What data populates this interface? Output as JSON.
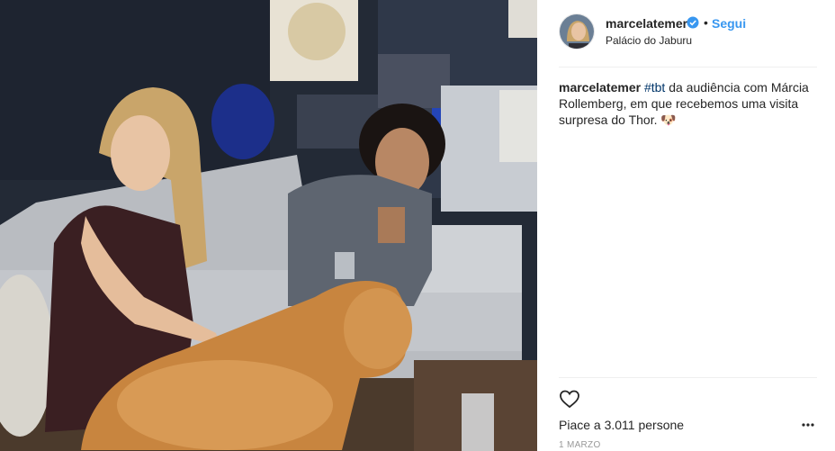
{
  "post": {
    "photo_description_icon": "photo",
    "username": "marcelatemer",
    "verified_icon": "verified-badge-icon",
    "separator": "•",
    "follow_label": "Segui",
    "location": "Palácio do Jaburu",
    "caption": {
      "username": "marcelatemer",
      "hashtag": "#tbt",
      "text": " da audiência com Márcia Rollemberg, em que recebemos uma visita surpresa do Thor. 🐶"
    },
    "likes_text": "Piace a 3.011 persone",
    "date": "1 MARZO",
    "colors": {
      "link_blue": "#3897f0",
      "hashtag": "#003569",
      "text": "#262626"
    }
  }
}
